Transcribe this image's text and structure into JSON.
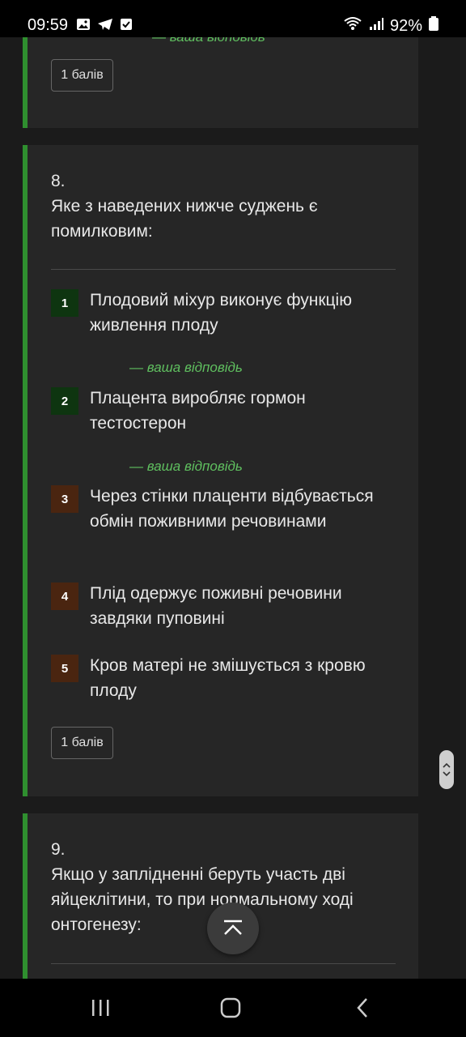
{
  "status_bar": {
    "time": "09:59",
    "battery": "92%",
    "left_icons": [
      "image-icon",
      "telegram-icon",
      "check-box-icon"
    ],
    "right_icons": [
      "wifi-icon",
      "signal-icon",
      "battery-icon"
    ]
  },
  "question7": {
    "your_answer": "— ваша відповідь",
    "points": "1 балів"
  },
  "question8": {
    "number": "8.",
    "text": "Яке з наведених нижче суджень є помилковим:",
    "options": [
      {
        "num": "1",
        "text": "Плодовий міхур виконує функцію живлення плоду",
        "color": "#0e3510"
      },
      {
        "num": "2",
        "text": "Плацента виробляє гормон тестостерон",
        "color": "#0e3510"
      },
      {
        "num": "3",
        "text": "Через стінки плаценти відбувається обмін поживними речовинами",
        "color": "#4a2510"
      },
      {
        "num": "4",
        "text": "Плід одержує поживні речовини завдяки пуповині",
        "color": "#4a2510"
      },
      {
        "num": "5",
        "text": "Кров матері не змішується з кровю плоду",
        "color": "#4a2510"
      }
    ],
    "your_answer_1": "— ваша відповідь",
    "your_answer_2": "— ваша відповідь",
    "points": "1 балів"
  },
  "question9": {
    "number": "9.",
    "text": "Якщо у заплідненні беруть участь дві яйцеклітини, то при нормальному ході онтогенезу:"
  },
  "colors": {
    "accent_border": "#2f8f2f",
    "your_answer": "#5fbf5f",
    "card_bg": "#262626",
    "page_bg": "#1b1b1b"
  }
}
